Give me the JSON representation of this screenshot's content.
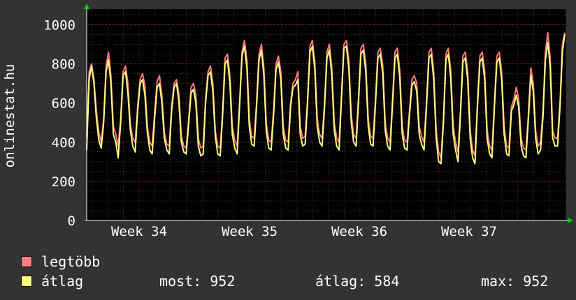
{
  "chart_data": {
    "type": "line",
    "ylabel": "onlinestat.hu",
    "ylim": [
      0,
      1080
    ],
    "yticks": [
      0,
      200,
      400,
      600,
      800,
      1000
    ],
    "xticks": [
      "Week 34",
      "Week 35",
      "Week 36",
      "Week 37"
    ],
    "grid": true,
    "legend_placement": "bottom",
    "series": [
      {
        "name": "legtöbb",
        "color": "#ff7b80",
        "values": [
          420,
          760,
          800,
          720,
          560,
          450,
          400,
          520,
          790,
          860,
          740,
          480,
          440,
          380,
          520,
          760,
          790,
          700,
          490,
          420,
          400,
          580,
          720,
          750,
          690,
          480,
          400,
          380,
          550,
          710,
          740,
          640,
          450,
          390,
          380,
          580,
          700,
          720,
          650,
          430,
          380,
          370,
          510,
          680,
          700,
          640,
          420,
          370,
          380,
          620,
          760,
          790,
          700,
          460,
          380,
          370,
          550,
          830,
          850,
          740,
          480,
          410,
          380,
          600,
          860,
          920,
          820,
          520,
          430,
          420,
          600,
          850,
          900,
          780,
          500,
          410,
          400,
          560,
          800,
          840,
          760,
          480,
          410,
          400,
          600,
          700,
          720,
          760,
          480,
          420,
          430,
          620,
          890,
          920,
          810,
          520,
          440,
          420,
          600,
          860,
          900,
          780,
          500,
          420,
          400,
          650,
          900,
          920,
          820,
          540,
          440,
          420,
          630,
          880,
          900,
          800,
          520,
          430,
          420,
          620,
          860,
          880,
          790,
          500,
          420,
          400,
          610,
          860,
          880,
          770,
          480,
          410,
          400,
          560,
          720,
          740,
          700,
          480,
          430,
          400,
          600,
          860,
          880,
          760,
          460,
          350,
          320,
          520,
          850,
          880,
          770,
          480,
          400,
          350,
          560,
          840,
          860,
          760,
          460,
          360,
          330,
          600,
          840,
          860,
          760,
          460,
          380,
          360,
          600,
          840,
          860,
          760,
          480,
          380,
          370,
          580,
          620,
          680,
          620,
          420,
          370,
          360,
          540,
          780,
          700,
          460,
          380,
          400,
          560,
          860,
          960,
          820,
          460,
          420,
          420,
          600,
          900,
          960
        ]
      },
      {
        "name": "átlag",
        "color": "#ffff80",
        "values": [
          360,
          720,
          790,
          700,
          520,
          410,
          370,
          500,
          760,
          820,
          700,
          440,
          400,
          320,
          500,
          740,
          760,
          650,
          460,
          380,
          350,
          560,
          700,
          720,
          640,
          450,
          360,
          340,
          520,
          680,
          700,
          600,
          420,
          360,
          340,
          560,
          680,
          700,
          610,
          400,
          350,
          340,
          490,
          650,
          670,
          600,
          380,
          330,
          340,
          600,
          740,
          760,
          660,
          430,
          340,
          330,
          530,
          800,
          820,
          700,
          440,
          370,
          340,
          580,
          840,
          890,
          780,
          480,
          390,
          380,
          580,
          820,
          870,
          740,
          460,
          370,
          360,
          540,
          770,
          810,
          720,
          440,
          370,
          360,
          580,
          680,
          690,
          720,
          440,
          380,
          390,
          600,
          860,
          890,
          770,
          480,
          400,
          380,
          580,
          830,
          870,
          740,
          460,
          380,
          360,
          630,
          880,
          890,
          780,
          500,
          400,
          380,
          610,
          850,
          870,
          760,
          480,
          390,
          380,
          600,
          830,
          850,
          750,
          460,
          380,
          360,
          590,
          830,
          850,
          730,
          440,
          370,
          360,
          540,
          690,
          710,
          660,
          440,
          390,
          360,
          580,
          830,
          850,
          720,
          420,
          300,
          290,
          500,
          820,
          850,
          730,
          440,
          360,
          300,
          540,
          810,
          830,
          720,
          420,
          320,
          290,
          580,
          810,
          830,
          720,
          420,
          340,
          320,
          580,
          810,
          830,
          720,
          440,
          340,
          330,
          560,
          590,
          640,
          580,
          380,
          330,
          320,
          520,
          740,
          660,
          420,
          340,
          360,
          530,
          820,
          910,
          780,
          420,
          380,
          380,
          580,
          860,
          952
        ]
      }
    ]
  },
  "legend": {
    "max_label": "legtöbb",
    "avg_label": "átlag",
    "now": "most: 952",
    "average": "átlag: 584",
    "maximum": "max: 952"
  }
}
